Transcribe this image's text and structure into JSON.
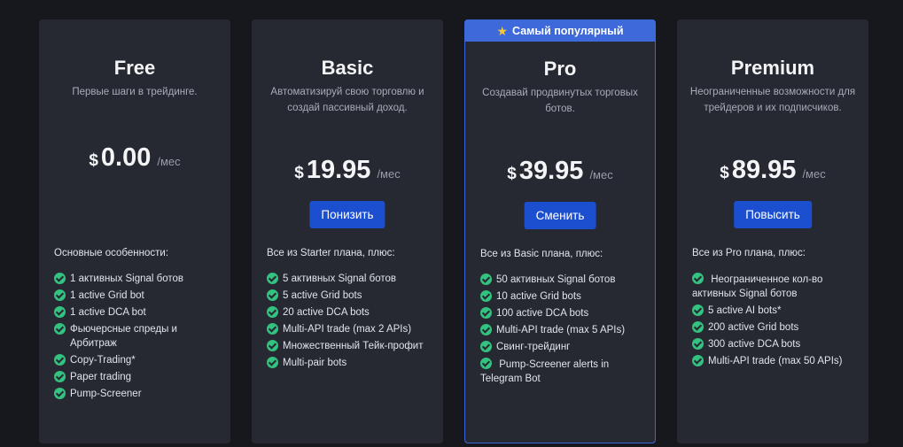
{
  "colors": {
    "background": "#17181d",
    "card": "#262832",
    "accent": "#1c4fd0",
    "ribbon": "#3d69db",
    "check": "#33c27f"
  },
  "plans": [
    {
      "name": "Free",
      "description": "Первые шаги в трейдинге.",
      "currency": "$",
      "price": "0.00",
      "period": "/мес",
      "button": "",
      "features_heading": "Основные особенности:",
      "features": [
        "1 активных Signal ботов",
        "1 active Grid bot",
        "1 active DCA bot",
        "Фьючерсные спреды и Арбитраж",
        "Copy-Trading*",
        "Paper trading",
        "Pump-Screener"
      ]
    },
    {
      "name": "Basic",
      "description": "Автоматизируй свою торговлю и создай пассивный доход.",
      "currency": "$",
      "price": "19.95",
      "period": "/мес",
      "button": "Понизить",
      "features_heading": "Все из Starter плана, плюс:",
      "features": [
        "5 активных Signal ботов",
        "5 active Grid bots",
        "20 active DCA bots",
        "Multi-API trade (max 2 APIs)",
        "Множественный Тейк-профит",
        "Multi-pair bots"
      ]
    },
    {
      "name": "Pro",
      "badge": "Самый популярный",
      "badge_icon": "star-icon",
      "description": "Создавай продвинутых торговых ботов.",
      "currency": "$",
      "price": "39.95",
      "period": "/мес",
      "button": "Сменить",
      "features_heading": "Все из Basic плана, плюс:",
      "features": [
        "50 активных Signal ботов",
        "10 active Grid bots",
        "100 active DCA bots",
        "Multi-API trade (max 5 APIs)",
        "Свинг-трейдинг",
        "Pump-Screener alerts in Telegram Bot"
      ]
    },
    {
      "name": "Premium",
      "description": "Неограниченные возможности для трейдеров и их подписчиков.",
      "currency": "$",
      "price": "89.95",
      "period": "/мес",
      "button": "Повысить",
      "features_heading": "Все из Pro плана, плюс:",
      "features": [
        "Неограниченное кол-во активных Signal ботов",
        "5 active AI bots*",
        "200 active Grid bots",
        "300 active DCA bots",
        "Multi-API trade (max 50 APIs)"
      ]
    }
  ]
}
